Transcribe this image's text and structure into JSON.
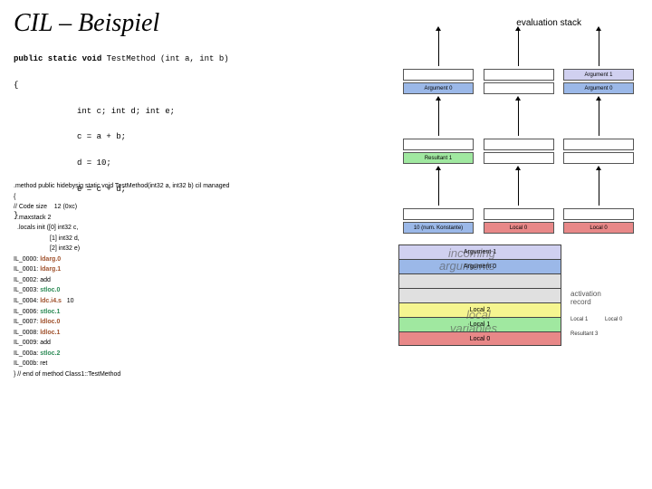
{
  "title": "CIL – Beispiel",
  "eval_label": "evaluation stack",
  "csharp": {
    "sig_kw": "public static void",
    "sig_rest": " TestMethod (int a, int b)",
    "open": "{",
    "l1": "int c; int d; int e;",
    "l2": "c = a + b;",
    "l3": "d = 10;",
    "l4": "e = c + d;",
    "close": "}"
  },
  "cil": {
    "head": ".method public hidebysig static void  TestMethod(int32 a, int32 b) cil managed",
    "open": "{",
    "codesize_l": "// Code size",
    "codesize_v": "12 (0xc)",
    "maxstack": ".maxstack  2",
    "locals0": ".locals init ([0] int32 c,",
    "locals1": "[1] int32 d,",
    "locals2": "[2] int32 e)",
    "i0": "IL_0000:",
    "o0": "ldarg.0",
    "i1": "IL_0001:",
    "o1": "ldarg.1",
    "i2": "IL_0002:",
    "o2": "add",
    "i3": "IL_0003:",
    "o3": "stloc.0",
    "i4": "IL_0004:",
    "o4": "ldc.i4.s",
    "v4": "10",
    "i6": "IL_0006:",
    "o6": "stloc.1",
    "i7": "IL_0007:",
    "o7": "ldloc.0",
    "i8": "IL_0008:",
    "o8": "ldloc.1",
    "i9": "IL_0009:",
    "o9": "add",
    "ia": "IL_000a:",
    "oa": "stloc.2",
    "ib": "IL_000b:",
    "ob": "ret",
    "end": "} // end of method Class1::TestMethod"
  },
  "stack": {
    "row1": {
      "a": "",
      "b": "",
      "c": "Argument 1"
    },
    "row2": {
      "a": "Argument 0",
      "b": "",
      "c": "Argument 0"
    }
  },
  "stack2": {
    "row1": {
      "a": "",
      "b": "",
      "c": ""
    },
    "row2": {
      "a": "Resultant 1",
      "b": "",
      "c": ""
    }
  },
  "stack3": {
    "row1": {
      "a": "",
      "b": "",
      "c": ""
    },
    "row2": {
      "a": "10 (num. Konstante)",
      "b": "Local 0",
      "c": "Local 0"
    }
  },
  "stack4": {
    "row1": {
      "a": "",
      "b": "",
      "c": ""
    },
    "row2": {
      "a": "",
      "b": "",
      "c": "Resultant 3"
    }
  },
  "rec": {
    "r0": "Argument 1",
    "r1": "Argument 0",
    "r2": "Local 2",
    "r3": "Local 1",
    "r4": "Local 0",
    "ov1": "incoming",
    "ov2": "arguments",
    "ov3": "local",
    "ov4": "variables",
    "act": "activation\nrecord",
    "kv1": "Local 1",
    "kv2": "Local 0",
    "kv3": "Resultant 3"
  }
}
